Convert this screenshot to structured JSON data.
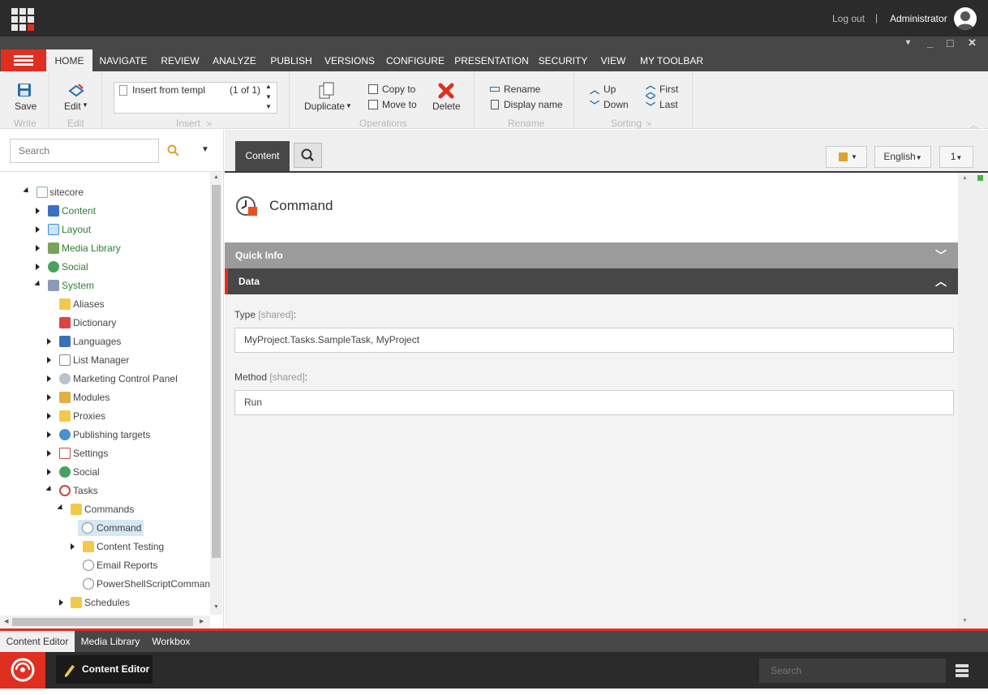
{
  "topbar": {
    "logout": "Log out",
    "separator": "|",
    "user": "Administrator"
  },
  "window": {
    "min": "_",
    "max": "□",
    "close": "✕",
    "caret": "▾"
  },
  "ribbon_tabs": [
    "HOME",
    "NAVIGATE",
    "REVIEW",
    "ANALYZE",
    "PUBLISH",
    "VERSIONS",
    "CONFIGURE",
    "PRESENTATION",
    "SECURITY",
    "VIEW",
    "MY TOOLBAR"
  ],
  "ribbon": {
    "save": "Save",
    "write": "Write",
    "edit": "Edit",
    "edit_group": "Edit",
    "insert_item": "Insert from templ",
    "insert_count": "(1 of 1)",
    "insert_group": "Insert",
    "duplicate": "Duplicate",
    "copy_to": "Copy to",
    "move_to": "Move to",
    "delete": "Delete",
    "operations": "Operations",
    "rename": "Rename",
    "display_name": "Display name",
    "rename_group": "Rename",
    "up": "Up",
    "down": "Down",
    "first": "First",
    "last": "Last",
    "sorting": "Sorting"
  },
  "search": {
    "placeholder": "Search"
  },
  "tree": [
    {
      "label": "sitecore",
      "green": false
    },
    {
      "label": "Content",
      "green": true
    },
    {
      "label": "Layout",
      "green": true
    },
    {
      "label": "Media Library",
      "green": true
    },
    {
      "label": "Social",
      "green": true
    },
    {
      "label": "System",
      "green": true
    },
    {
      "label": "Aliases",
      "green": false
    },
    {
      "label": "Dictionary",
      "green": false
    },
    {
      "label": "Languages",
      "green": false
    },
    {
      "label": "List Manager",
      "green": false
    },
    {
      "label": "Marketing Control Panel",
      "green": false
    },
    {
      "label": "Modules",
      "green": false
    },
    {
      "label": "Proxies",
      "green": false
    },
    {
      "label": "Publishing targets",
      "green": false
    },
    {
      "label": "Settings",
      "green": false
    },
    {
      "label": "Social",
      "green": false
    },
    {
      "label": "Tasks",
      "green": false
    },
    {
      "label": "Commands",
      "green": false
    },
    {
      "label": "Command",
      "green": false
    },
    {
      "label": "Content Testing",
      "green": false
    },
    {
      "label": "Email Reports",
      "green": false
    },
    {
      "label": "PowerShellScriptCommand",
      "green": false
    },
    {
      "label": "Schedules",
      "green": false
    }
  ],
  "editor": {
    "content_tab": "Content",
    "language": "English",
    "version": "1",
    "item_title": "Command",
    "quick_info": "Quick Info",
    "data_section": "Data",
    "fields": [
      {
        "label": "Type",
        "shared": "[shared]",
        "colon": ":",
        "value": "MyProject.Tasks.SampleTask, MyProject"
      },
      {
        "label": "Method",
        "shared": "[shared]",
        "colon": ":",
        "value": "Run"
      }
    ]
  },
  "bottom_tabs": [
    "Content Editor",
    "Media Library",
    "Workbox"
  ],
  "taskbar": {
    "app": "Content Editor",
    "search_placeholder": "Search"
  },
  "colors": {
    "accent": "#e02e20",
    "dark": "#2b2b2b",
    "tabbar": "#474747",
    "tree_green": "#2f7d32"
  }
}
